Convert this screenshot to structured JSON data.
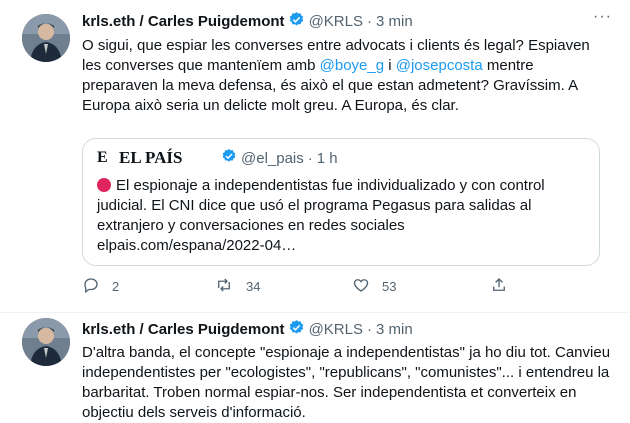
{
  "tweet1": {
    "display_name": "krls.eth / Carles Puigdemont",
    "handle": "@KRLS",
    "separator": "·",
    "time": "3 min",
    "text_part1": "O sigui, que espiar les converses entre advocats i clients és legal? Espiaven les converses que mantenïem amb ",
    "mention1": "@boye_g",
    "text_part2": " i ",
    "mention2": "@josepcosta",
    "text_part3": " mentre preparaven la meva defensa, és això el que estan admetent? Gravíssim. A Europa això seria un delicte molt greu. A Europa, és clar.",
    "quote": {
      "logo": "E",
      "name": "EL PAÍS",
      "handle": "@el_pais",
      "separator": "·",
      "time": "1 h",
      "text": "El espionaje a independentistas fue individualizado y con control judicial. El CNI dice que usó el programa Pegasus para salidas al extranjero y conversaciones en redes sociales",
      "link": "elpais.com/espana/2022-04…"
    },
    "actions": {
      "replies": "2",
      "retweets": "34",
      "likes": "53"
    }
  },
  "tweet2": {
    "display_name": "krls.eth / Carles Puigdemont",
    "handle": "@KRLS",
    "separator": "·",
    "time": "3 min",
    "text": "D'altra banda, el concepte \"espionaje a independentistas\" ja ho diu tot. Canvieu independentistes per \"ecologistes\", \"republicans\", \"comunistes\"... i entendreu la barbaritat. Troben normal espiar-nos. Ser independentista et converteix en objectiu dels serveis d'informació."
  },
  "colors": {
    "verified": "#1d9bf0",
    "mention": "#1d9bf0",
    "secondary_text": "#536471",
    "border": "#cfd9de",
    "red_circle": "#e0245e"
  },
  "icons": [
    "verified-badge-icon",
    "more-icon",
    "reply-icon",
    "retweet-icon",
    "like-icon",
    "share-icon",
    "red-circle-icon"
  ]
}
